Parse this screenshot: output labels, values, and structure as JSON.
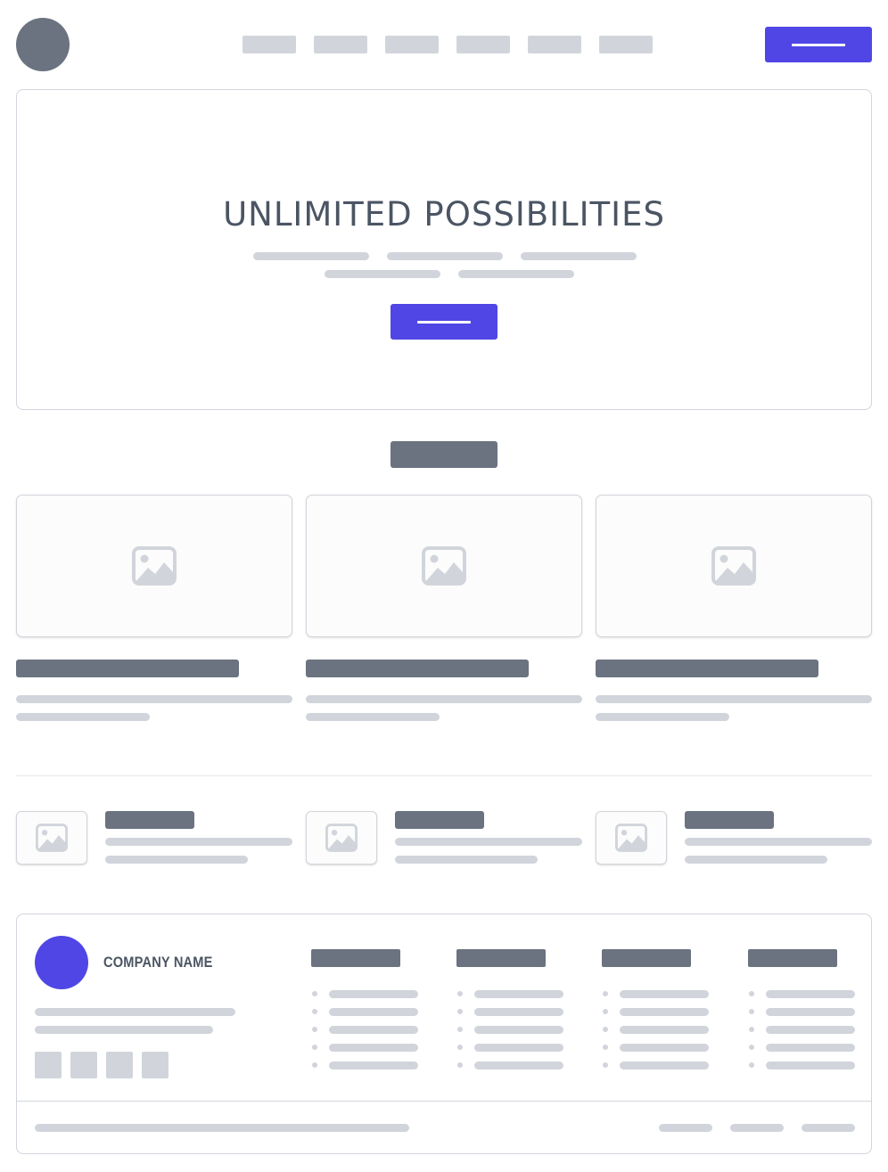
{
  "header": {
    "logo_icon": "circle-logo",
    "nav_items": [
      "",
      "",
      "",
      "",
      "",
      ""
    ],
    "cta_button_label": ""
  },
  "hero": {
    "title": "UNLIMITED POSSIBILITIES",
    "cta_button_label": ""
  },
  "features": {
    "section_heading": "",
    "cards": [
      {
        "image_icon": "image-icon",
        "title": "",
        "text": ""
      },
      {
        "image_icon": "image-icon",
        "title": "",
        "text": ""
      },
      {
        "image_icon": "image-icon",
        "title": "",
        "text": ""
      }
    ]
  },
  "mini_features": [
    {
      "image_icon": "image-icon",
      "title": "",
      "text": ""
    },
    {
      "image_icon": "image-icon",
      "title": "",
      "text": ""
    },
    {
      "image_icon": "image-icon",
      "title": "",
      "text": ""
    }
  ],
  "footer": {
    "company_name": "COMPANY NAME",
    "logo_icon": "circle-logo",
    "social_icons": [
      "",
      "",
      "",
      ""
    ],
    "columns": [
      {
        "heading": "",
        "links": [
          "",
          "",
          "",
          "",
          ""
        ]
      },
      {
        "heading": "",
        "links": [
          "",
          "",
          "",
          "",
          ""
        ]
      },
      {
        "heading": "",
        "links": [
          "",
          "",
          "",
          "",
          ""
        ]
      },
      {
        "heading": "",
        "links": [
          "",
          "",
          "",
          "",
          ""
        ]
      }
    ],
    "bottom_links": [
      "",
      "",
      ""
    ]
  },
  "colors": {
    "accent": "#4f46e5",
    "placeholder_light": "#d1d5db",
    "placeholder_dark": "#6b7280",
    "title_text": "#4b5563"
  }
}
